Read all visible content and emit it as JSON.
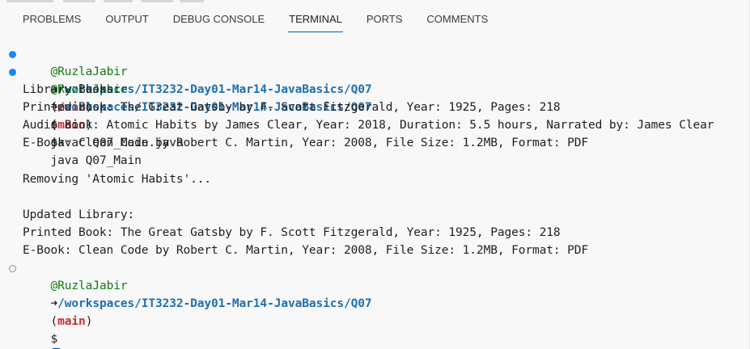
{
  "tabs": [
    {
      "label": "PROBLEMS",
      "active": false
    },
    {
      "label": "OUTPUT",
      "active": false
    },
    {
      "label": "DEBUG CONSOLE",
      "active": false
    },
    {
      "label": "TERMINAL",
      "active": true
    },
    {
      "label": "PORTS",
      "active": false
    },
    {
      "label": "COMMENTS",
      "active": false
    }
  ],
  "prompt": {
    "user": "@RuzlaJabir",
    "arrow": "➜",
    "path": "/workspaces/IT3232-Day01-Mar14-JavaBasics/Q07",
    "branch": "main",
    "symbol": "$"
  },
  "commands": [
    "javac Q07_Main.java",
    "java Q07_Main"
  ],
  "output": [
    "Library Books:",
    "Printed Book: The Great Gatsby by F. Scott Fitzgerald, Year: 1925, Pages: 218",
    "Audio Book: Atomic Habits by James Clear, Year: 2018, Duration: 5.5 hours, Narrated by: James Clear",
    "E-Book: Clean Code by Robert C. Martin, Year: 2008, File Size: 1.2MB, Format: PDF",
    "",
    "Removing 'Atomic Habits'...",
    "",
    "Updated Library:",
    "Printed Book: The Great Gatsby by F. Scott Fitzgerald, Year: 1925, Pages: 218",
    "E-Book: Clean Code by Robert C. Martin, Year: 2008, File Size: 1.2MB, Format: PDF"
  ],
  "colors": {
    "accent": "#005fb8",
    "decoration_success": "#1a85ff",
    "user": "#0f7b0f",
    "path": "#1f6fb0",
    "branch": "#c72e2e"
  }
}
